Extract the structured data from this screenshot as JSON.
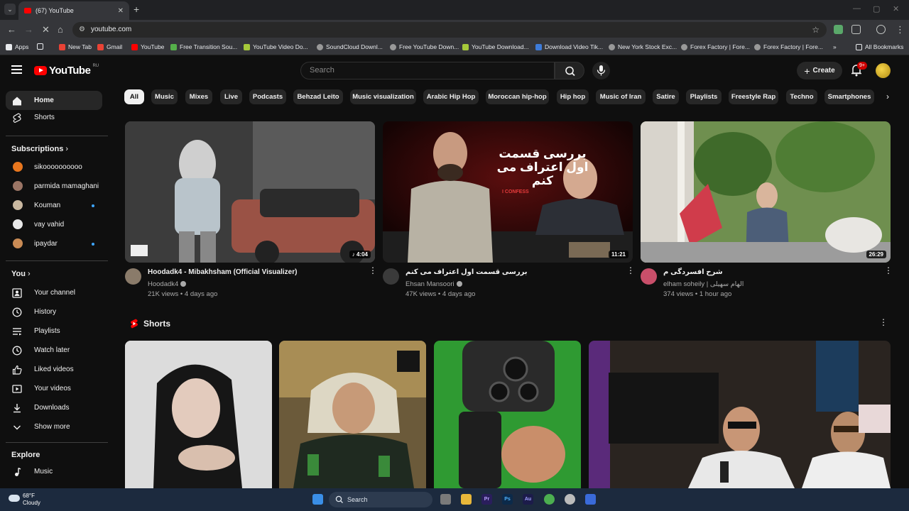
{
  "browser": {
    "tab_title": "(67) YouTube",
    "url": "youtube.com",
    "bookmarks": [
      "Apps",
      "New Tab",
      "Gmail",
      "YouTube",
      "Free Transition Sou...",
      "YouTube Video Do...",
      "SoundCloud Downl...",
      "Free YouTube Down...",
      "YouTube Download...",
      "Download Video Tik...",
      "New York Stock Exc...",
      "Forex Factory | Fore...",
      "Forex Factory | Fore..."
    ],
    "all_bookmarks": "All Bookmarks"
  },
  "header": {
    "logo_text": "YouTube",
    "region": "RU",
    "search_placeholder": "Search",
    "create_label": "Create",
    "notification_badge": "9+"
  },
  "sidebar": {
    "home": "Home",
    "shorts": "Shorts",
    "subscriptions_title": "Subscriptions",
    "subscriptions": [
      {
        "name": "sikoooooooooo",
        "color": "#e8761e",
        "new": false
      },
      {
        "name": "parmida mamaghani",
        "color": "#9b7565",
        "new": false
      },
      {
        "name": "Kouman",
        "color": "#c9b8a0",
        "new": true
      },
      {
        "name": "vay vahid",
        "color": "#e8e8e8",
        "new": false
      },
      {
        "name": "ipaydar",
        "color": "#c98b55",
        "new": true
      }
    ],
    "you_title": "You",
    "you_items": [
      "Your channel",
      "History",
      "Playlists",
      "Watch later",
      "Liked videos",
      "Your videos",
      "Downloads",
      "Show more"
    ],
    "explore_title": "Explore",
    "explore_items": [
      "Music"
    ]
  },
  "chips": [
    "All",
    "Music",
    "Mixes",
    "Live",
    "Podcasts",
    "Behzad Leito",
    "Music visualization",
    "Arabic Hip Hop",
    "Moroccan hip-hop",
    "Hip hop",
    "Music of Iran",
    "Satire",
    "Playlists",
    "Freestyle Rap",
    "Techno",
    "Smartphones"
  ],
  "videos": [
    {
      "title": "Hoodadk4 - Mibakhsham (Official Visualizer)",
      "channel": "Hoodadk4",
      "meta": "21K views • 4 days ago",
      "duration": "♪ 4:04",
      "verified": true
    },
    {
      "title": "بررسی قسمت اول اعتراف می کنم",
      "channel": "Ehsan Mansoori",
      "meta": "47K views • 4 days ago",
      "duration": "11:21",
      "verified": true,
      "thumb_text": "بررسی قسمت اول اعتراف می کنم",
      "thumb_sub": "I CONFESS"
    },
    {
      "title": "شرح افسردگی م",
      "channel": "elham soheily | الهام سهیلی",
      "meta": "374 views • 1 hour ago",
      "duration": "26:29",
      "verified": false
    }
  ],
  "shorts_title": "Shorts",
  "taskbar": {
    "temp": "68°F",
    "condition": "Cloudy",
    "search": "Search"
  }
}
